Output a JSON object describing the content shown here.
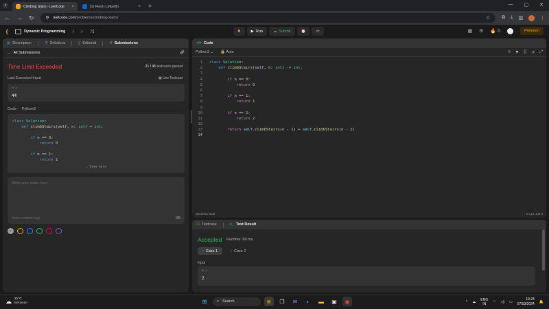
{
  "browser": {
    "tabs": [
      {
        "title": "Climbing Stairs - LeetCode",
        "active": true,
        "favicon_color": "#ffa116"
      },
      {
        "title": "(1) Feed | LinkedIn",
        "active": false,
        "favicon_color": "#0a66c2"
      }
    ],
    "url_host": "leetcode.com",
    "url_path": "/problems/climbing-stairs/"
  },
  "header": {
    "problem_list": "Dynamic Programming",
    "run_label": "Run",
    "submit_label": "Submit",
    "streak_count": "0",
    "premium_label": "Premium"
  },
  "left_panel": {
    "tabs": [
      "Description",
      "Solutions",
      "Editorial",
      "Submissions"
    ],
    "all_submissions": "All Submissions",
    "status": "Time Limit Exceeded",
    "passed_count": "21 / 45",
    "passed_suffix": "testcases passed",
    "last_input_label": "Last Executed Input",
    "use_testcase": "Use Testcase",
    "input_name": "n =",
    "input_value": "44",
    "code_label": "Code",
    "code_lang": "Python3",
    "code_lines": [
      "class Solution:",
      "    def climbStairs(self, n: int) -> int:",
      "",
      "        if n == 0:",
      "            return 0",
      "",
      "        if n == 1:",
      "            return 1"
    ],
    "view_more": "View more",
    "notes_placeholder": "Write your notes here",
    "related_tags": "Select related tags",
    "notes_count": "0/5",
    "note_colors": [
      "#9e9e9e",
      "#ffa116",
      "#1e88e5",
      "#2cbb5d",
      "#9c27b0",
      "#7e57c2"
    ]
  },
  "code_panel": {
    "title": "Code",
    "language": "Python3",
    "mode": "Auto",
    "saved": "Saved to local",
    "cursor": "Ln 14, Col 9",
    "line_count": 14
  },
  "result_panel": {
    "tab_testcase": "Testcase",
    "tab_result": "Test Result",
    "status": "Accepted",
    "runtime": "Runtime: 80 ms",
    "cases": [
      "Case 1",
      "Case 2"
    ],
    "input_label": "Input",
    "input_name": "n =",
    "input_value": "2"
  },
  "taskbar": {
    "temp": "21°C",
    "weather": "Berawan",
    "search": "Search",
    "lang_top": "ENG",
    "lang_bottom": "IN",
    "time": "19:24",
    "date": "07/03/2024"
  }
}
